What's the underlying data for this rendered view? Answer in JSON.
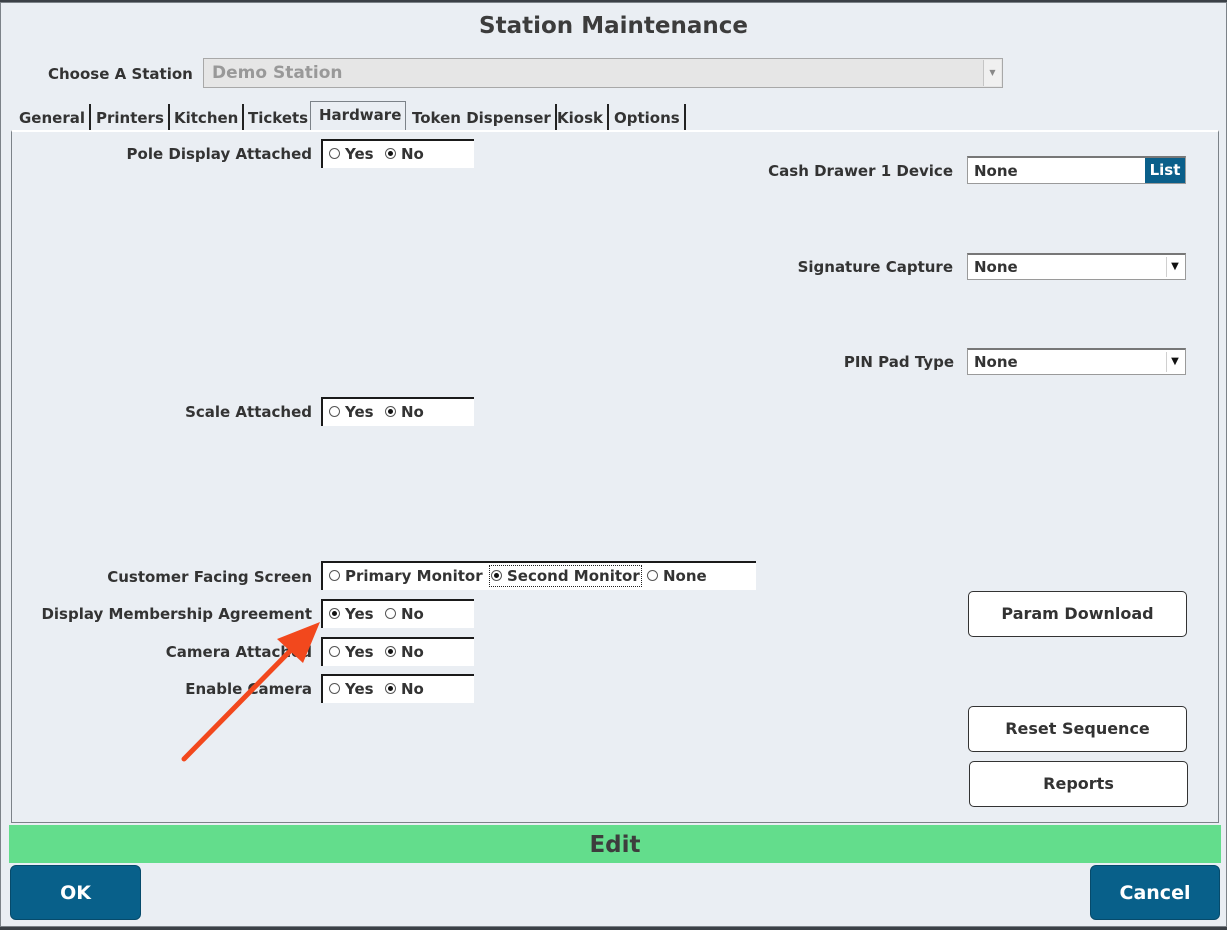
{
  "window": {
    "title": "Station Maintenance"
  },
  "station": {
    "label": "Choose A Station",
    "value": "Demo Station"
  },
  "tabs": [
    {
      "label": "General"
    },
    {
      "label": "Printers"
    },
    {
      "label": "Kitchen"
    },
    {
      "label": "Tickets"
    },
    {
      "label": "Hardware"
    },
    {
      "label": "Token Dispenser"
    },
    {
      "label": "Kiosk"
    },
    {
      "label": "Options"
    }
  ],
  "active_tab": "Hardware",
  "hardware": {
    "pole_display": {
      "label": "Pole Display Attached",
      "yes": "Yes",
      "no": "No",
      "selected": "No"
    },
    "scale": {
      "label": "Scale Attached",
      "yes": "Yes",
      "no": "No",
      "selected": "No"
    },
    "customer_screen": {
      "label": "Customer Facing Screen",
      "options": [
        "Primary Monitor",
        "Second Monitor",
        "None"
      ],
      "selected": "Second Monitor"
    },
    "membership": {
      "label": "Display Membership Agreement",
      "yes": "Yes",
      "no": "No",
      "selected": "Yes"
    },
    "camera_attached": {
      "label": "Camera Attached",
      "yes": "Yes",
      "no": "No",
      "selected": "No"
    },
    "enable_camera": {
      "label": "Enable Camera",
      "yes": "Yes",
      "no": "No",
      "selected": "No"
    },
    "cash_drawer": {
      "label": "Cash Drawer 1 Device",
      "value": "None",
      "list_button": "List"
    },
    "signature": {
      "label": "Signature Capture",
      "value": "None"
    },
    "pinpad": {
      "label": "PIN Pad Type",
      "value": "None"
    },
    "buttons": {
      "param_download": "Param Download",
      "reset_sequence": "Reset Sequence",
      "reports": "Reports"
    }
  },
  "mode_bar": "Edit",
  "footer": {
    "ok": "OK",
    "cancel": "Cancel"
  },
  "colors": {
    "accent": "#08608a",
    "mode_bar": "#63dd8c",
    "annotation_arrow": "#f2481d",
    "background": "#eaeef3"
  }
}
